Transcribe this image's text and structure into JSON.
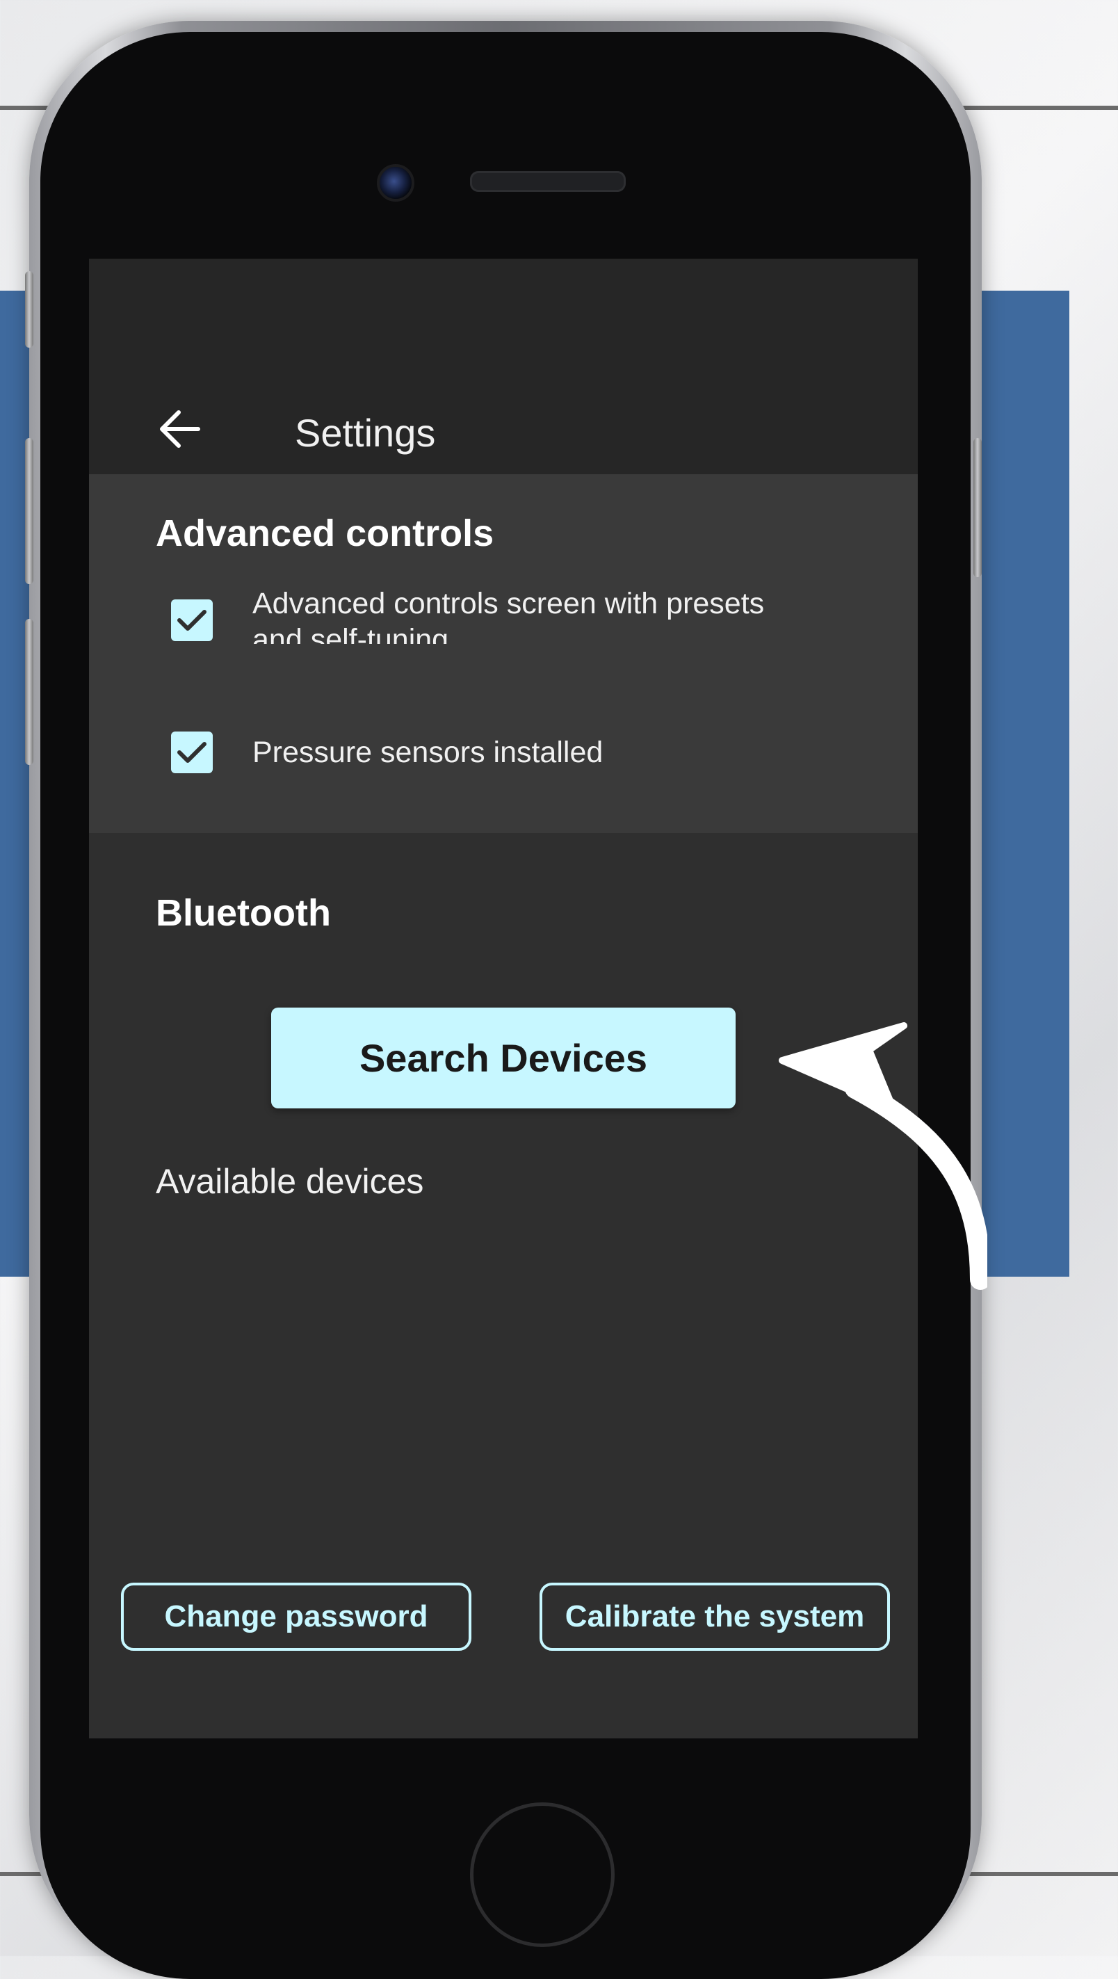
{
  "toolbar": {
    "title": "Settings",
    "back_icon": "arrow-left-icon"
  },
  "advanced": {
    "title": "Advanced controls",
    "items": [
      {
        "label": "Advanced controls screen with presets and self-tuning",
        "checked": true
      },
      {
        "label": "Pressure sensors installed",
        "checked": true
      }
    ]
  },
  "bluetooth": {
    "title": "Bluetooth",
    "search_label": "Search Devices",
    "available_label": "Available devices"
  },
  "footer": {
    "change_password_label": "Change password",
    "calibrate_label": "Calibrate the system"
  },
  "colors": {
    "accent": "#c7f7ff",
    "screen_bg": "#2f2f2f",
    "section_bg": "#3a3a3a",
    "background_panel": "#3f6a9e"
  }
}
